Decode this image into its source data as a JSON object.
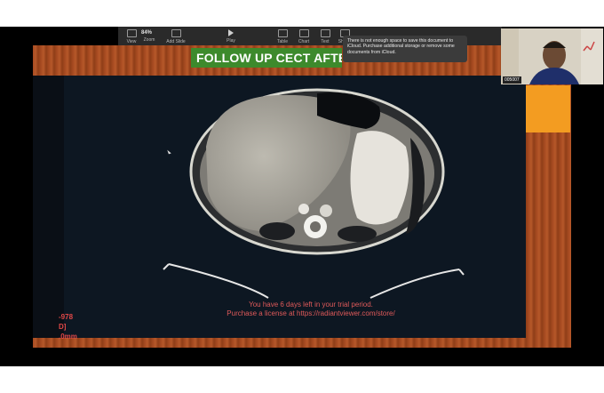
{
  "toolbar": {
    "zoom_value": "84%",
    "items": [
      "View",
      "Zoom",
      "Add Slide",
      "Play",
      "Table",
      "Chart",
      "Text",
      "Shape"
    ]
  },
  "notification": {
    "text": "There is not enough space to save this document to iCloud. Purchase additional storage or remove some documents from iCloud."
  },
  "slide": {
    "title": "FOLLOW UP CECT AFTER"
  },
  "viewer": {
    "trial_line1": "You have 6 days left in your trial period.",
    "trial_line2": "Purchase a license at https://radiantviewer.com/store/",
    "side_label_1": "-978",
    "side_label_2": "D]",
    "side_label_3": ".0mm"
  },
  "webcam": {
    "label": "005007"
  },
  "colors": {
    "slide_bg": "#a54a20",
    "title_bg": "#3d8a2c",
    "accent_orange": "#f39c21",
    "trial_text": "#e05a5a"
  }
}
